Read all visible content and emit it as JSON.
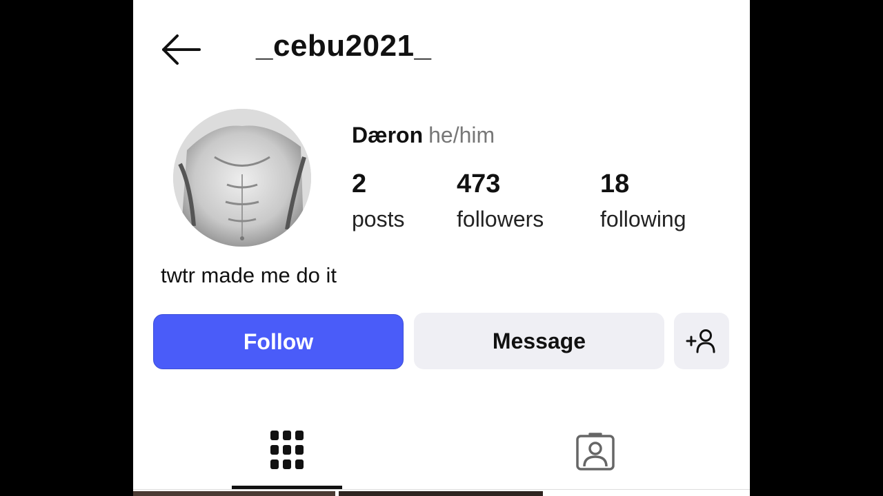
{
  "header": {
    "back_icon": "arrow-left-icon",
    "username": "_cebu2021_"
  },
  "profile": {
    "display_name": "Dæron",
    "pronouns": "he/him",
    "bio": "twtr made me do it",
    "stats": [
      {
        "value": "2",
        "label": "posts"
      },
      {
        "value": "473",
        "label": "followers"
      },
      {
        "value": "18",
        "label": "following"
      }
    ]
  },
  "actions": {
    "follow_label": "Follow",
    "message_label": "Message",
    "add_user_icon": "person-add-icon"
  },
  "tabs": [
    {
      "icon": "grid-icon",
      "selected": true
    },
    {
      "icon": "tagged-icon",
      "selected": false
    }
  ],
  "colors": {
    "follow_button": "#4a5cf9",
    "secondary_button": "#efeff4",
    "text": "#111111",
    "muted": "#777777"
  }
}
